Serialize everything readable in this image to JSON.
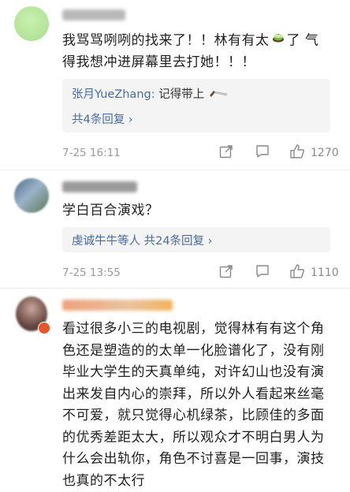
{
  "comments": [
    {
      "text_lines": [
        "我骂骂咧咧的找来了！！林有有太",
        "了 气",
        "得我想冲进屏幕里去打她！！！"
      ],
      "reply_author": "张月YueZhang:",
      "reply_text": "记得带上",
      "more": "共4条回复",
      "time": "7-25 16:11",
      "likes": "1270"
    },
    {
      "text": "学白百合演戏？",
      "more_author": "虔诚牛牛等人",
      "more": "共24条回复",
      "time": "7-25 13:55",
      "likes": "1110"
    },
    {
      "text_lines": [
        "看过很多小三的电视剧，觉得林有有这个角",
        "色还是塑造的的太单一化脸谱化了，没有刚",
        "毕业大学生的天真单纯，对许幻山也没有演",
        "出来发自内心的崇拜，所以外人看起来丝毫",
        "不可爱，就只觉得心机绿茶，比顾佳的多面",
        "的优秀差距太大，所以观众才不明白男人为",
        "什么会出轨你，角色不讨喜是一回事，演技",
        "也真的不太行"
      ]
    }
  ],
  "colors": {
    "link": "#476c9e",
    "meta": "#9a9a9a"
  }
}
